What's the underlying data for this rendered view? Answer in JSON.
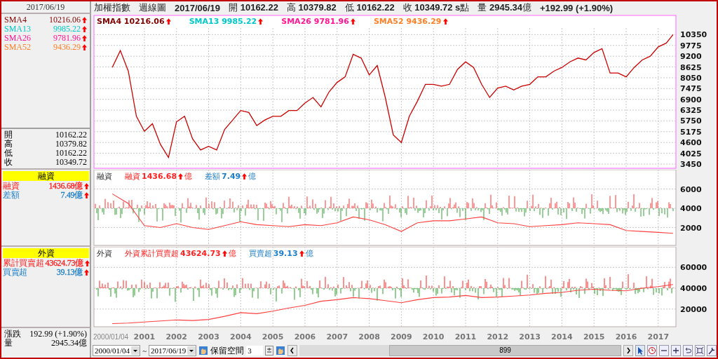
{
  "header": {
    "title": "加權指數",
    "period": "週線圖",
    "date": "2017/06/19",
    "quotes": [
      {
        "label": "開",
        "value": "10162.22"
      },
      {
        "label": "高",
        "value": "10379.82"
      },
      {
        "label": "低",
        "value": "10162.22"
      },
      {
        "label": "收",
        "value": "10349.72 s",
        "unit": "點"
      },
      {
        "label": "量",
        "value": "2945.34",
        "unit": "億"
      }
    ],
    "change": "+192.99 (+1.90%)"
  },
  "left_panel": {
    "date": "2017/06/19",
    "sma": [
      {
        "name": "SMA4",
        "value": "10216.06",
        "color": "#800000",
        "up": true
      },
      {
        "name": "SMA13",
        "value": "9985.22",
        "color": "#00c8c8",
        "up": true
      },
      {
        "name": "SMA26",
        "value": "9781.96",
        "color": "#ff1493",
        "up": true
      },
      {
        "name": "SMA52",
        "value": "9436.29",
        "color": "#ff7f27",
        "up": true
      }
    ],
    "ohlc": [
      {
        "label": "開",
        "value": "10162.22"
      },
      {
        "label": "高",
        "value": "10379.82"
      },
      {
        "label": "低",
        "value": "10162.22"
      },
      {
        "label": "收",
        "value": "10349.72"
      }
    ],
    "margin": {
      "title": "融資",
      "rows": [
        {
          "name": "融資",
          "value": "1436.68億",
          "color": "#ff2020",
          "up": true
        },
        {
          "name": "差額",
          "value": "7.49億",
          "color": "#1e7fc8",
          "up": true
        }
      ]
    },
    "foreign": {
      "title": "外資",
      "rows": [
        {
          "name": "累計買賣超",
          "value": "43624.73億",
          "color": "#ff2020",
          "up": true
        },
        {
          "name": "買賣超",
          "value": "39.13億",
          "color": "#1e7fc8",
          "up": true
        }
      ]
    },
    "summary": [
      {
        "label": "漲跌",
        "value": "192.99 (+1.90%)"
      },
      {
        "label": "量",
        "value": "2945.34億"
      }
    ]
  },
  "price_pane": {
    "legend": [
      {
        "name": "SMA4",
        "value": "10216.06",
        "color": "#800000",
        "up": true
      },
      {
        "name": "SMA13",
        "value": "9985.22",
        "color": "#00c8c8",
        "up": true
      },
      {
        "name": "SMA26",
        "value": "9781.96",
        "color": "#ff1493",
        "up": true
      },
      {
        "name": "SMA52",
        "value": "9436.29",
        "color": "#ff7f27",
        "up": true
      }
    ],
    "chart_data": {
      "type": "line",
      "grid": true,
      "xlim": [
        1999.43,
        2017.55
      ],
      "ylim": [
        3300,
        10700
      ],
      "yticks": [
        {
          "value": 3450,
          "label": "3450"
        },
        {
          "value": 4025,
          "label": "4025"
        },
        {
          "value": 4600,
          "label": "4600"
        },
        {
          "value": 5175,
          "label": "5175"
        },
        {
          "value": 5750,
          "label": "5750"
        },
        {
          "value": 6325,
          "label": "6325"
        },
        {
          "value": 6900,
          "label": "6900"
        },
        {
          "value": 7475,
          "label": "7475"
        },
        {
          "value": 8050,
          "label": "8050"
        },
        {
          "value": 8625,
          "label": "8625"
        },
        {
          "value": 9200,
          "label": "9200"
        },
        {
          "value": 9775,
          "label": "9775"
        },
        {
          "value": 10350,
          "label": "10350"
        }
      ],
      "x": [
        2000,
        2000.25,
        2000.5,
        2000.75,
        2001,
        2001.25,
        2001.5,
        2001.75,
        2002,
        2002.25,
        2002.5,
        2002.75,
        2003,
        2003.25,
        2003.5,
        2003.75,
        2004,
        2004.25,
        2004.5,
        2004.75,
        2005,
        2005.25,
        2005.5,
        2005.75,
        2006,
        2006.25,
        2006.5,
        2006.75,
        2007,
        2007.25,
        2007.5,
        2007.75,
        2008,
        2008.25,
        2008.5,
        2008.75,
        2009,
        2009.25,
        2009.5,
        2009.75,
        2010,
        2010.25,
        2010.5,
        2010.75,
        2011,
        2011.25,
        2011.5,
        2011.75,
        2012,
        2012.25,
        2012.5,
        2012.75,
        2013,
        2013.25,
        2013.5,
        2013.75,
        2014,
        2014.25,
        2014.5,
        2014.75,
        2015,
        2015.25,
        2015.5,
        2015.75,
        2016,
        2016.25,
        2016.5,
        2016.75,
        2017,
        2017.25,
        2017.46
      ],
      "series": [
        {
          "color": "#cc0000",
          "values": [
            8600,
            9500,
            8400,
            6000,
            5200,
            5600,
            4500,
            3800,
            5700,
            6000,
            4800,
            4200,
            4400,
            4200,
            5300,
            5800,
            6300,
            6200,
            5500,
            5800,
            6000,
            6000,
            6300,
            6300,
            6700,
            7000,
            6500,
            7300,
            7800,
            8100,
            9300,
            9100,
            8200,
            8700,
            7000,
            5000,
            4600,
            6000,
            6800,
            7700,
            7700,
            7600,
            7700,
            8500,
            8900,
            8600,
            7700,
            7000,
            7500,
            7600,
            7400,
            7600,
            7700,
            8100,
            8100,
            8400,
            8600,
            8900,
            9100,
            9000,
            9400,
            9600,
            8300,
            8300,
            8100,
            8600,
            9000,
            9200,
            9700,
            9900,
            10350
          ]
        }
      ]
    }
  },
  "margin_pane": {
    "title": "融資",
    "legend": [
      {
        "name": "融資",
        "value": "1436.68",
        "unit": "億",
        "color": "#ff2020",
        "up": true
      },
      {
        "name": "差額",
        "value": "7.49",
        "unit": "億",
        "color": "#1e7fc8",
        "up": true
      }
    ],
    "chart_data": {
      "type": "line",
      "grid": true,
      "xlim": [
        1999.43,
        2017.55
      ],
      "ylim": [
        150,
        8000
      ],
      "yticks": [
        {
          "value": 2000,
          "label": "2000"
        },
        {
          "value": 4000,
          "label": "4000"
        },
        {
          "value": 6000,
          "label": "6000"
        }
      ],
      "x": [
        2000,
        2000.5,
        2001,
        2001.5,
        2002,
        2002.5,
        2003,
        2003.5,
        2004,
        2004.5,
        2005,
        2005.5,
        2006,
        2006.5,
        2007,
        2007.5,
        2008,
        2008.5,
        2009,
        2009.5,
        2010,
        2010.5,
        2011,
        2011.5,
        2012,
        2012.5,
        2013,
        2013.5,
        2014,
        2014.5,
        2015,
        2015.5,
        2016,
        2016.5,
        2017,
        2017.46
      ],
      "series": [
        {
          "color": "#ff4040",
          "values": [
            5500,
            4500,
            2200,
            2000,
            2400,
            2000,
            1800,
            2200,
            2600,
            2300,
            2200,
            2100,
            2300,
            2200,
            2500,
            3100,
            2800,
            2300,
            1600,
            2500,
            2700,
            2700,
            2900,
            3100,
            2500,
            2400,
            2100,
            2200,
            2300,
            2500,
            2400,
            2300,
            1700,
            1600,
            1500,
            1400
          ]
        }
      ]
    }
  },
  "foreign_pane": {
    "title": "外資",
    "legend": [
      {
        "name": "外資累計買賣超",
        "value": "43624.73",
        "unit": "億",
        "color": "#ff2020",
        "up": true
      },
      {
        "name": "買賣超",
        "value": "39.13",
        "unit": "億",
        "color": "#1e7fc8",
        "up": true
      }
    ],
    "chart_data": {
      "type": "line",
      "grid": true,
      "xlim": [
        1999.43,
        2017.55
      ],
      "ylim": [
        3000,
        79700
      ],
      "yticks": [
        {
          "value": 20000,
          "label": "20000"
        },
        {
          "value": 40000,
          "label": "40000"
        },
        {
          "value": 60000,
          "label": "60000"
        }
      ],
      "xticks": [
        {
          "value": 2001,
          "label": "2001"
        },
        {
          "value": 2002,
          "label": "2002"
        },
        {
          "value": 2003,
          "label": "2003"
        },
        {
          "value": 2004,
          "label": "2004"
        },
        {
          "value": 2005,
          "label": "2005"
        },
        {
          "value": 2006,
          "label": "2006"
        },
        {
          "value": 2007,
          "label": "2007"
        },
        {
          "value": 2008,
          "label": "2008"
        },
        {
          "value": 2009,
          "label": "2009"
        },
        {
          "value": 2010,
          "label": "2010"
        },
        {
          "value": 2011,
          "label": "2011"
        },
        {
          "value": 2012,
          "label": "2012"
        },
        {
          "value": 2013,
          "label": "2013"
        },
        {
          "value": 2014,
          "label": "2014"
        },
        {
          "value": 2015,
          "label": "2015"
        },
        {
          "value": 2016,
          "label": "2016"
        },
        {
          "value": 2017,
          "label": "2017"
        }
      ],
      "x": [
        2000,
        2000.5,
        2001,
        2001.5,
        2002,
        2002.5,
        2003,
        2003.5,
        2004,
        2004.5,
        2005,
        2005.5,
        2006,
        2006.5,
        2007,
        2007.5,
        2008,
        2008.5,
        2009,
        2009.5,
        2010,
        2010.5,
        2011,
        2011.5,
        2012,
        2012.5,
        2013,
        2013.5,
        2014,
        2014.5,
        2015,
        2015.5,
        2016,
        2016.5,
        2017,
        2017.46
      ],
      "series": [
        {
          "color": "#ff4040",
          "values": [
            6000,
            6500,
            7500,
            8500,
            9500,
            9000,
            10000,
            13000,
            16500,
            15500,
            18000,
            21000,
            23500,
            27500,
            29000,
            31000,
            30000,
            28000,
            26000,
            29000,
            31000,
            31500,
            33000,
            31000,
            31500,
            32500,
            33500,
            35000,
            36000,
            38000,
            39000,
            38000,
            37500,
            40000,
            41500,
            43600
          ]
        }
      ]
    }
  },
  "time_axis": {
    "start_label": "2000/01/04"
  },
  "toolbar": {
    "start_date": "2000/01/04",
    "end_date": "2017/06/19",
    "separator": "~",
    "reserve_label": "保留空間",
    "reserve_value": "3",
    "scroll_label": "899"
  }
}
